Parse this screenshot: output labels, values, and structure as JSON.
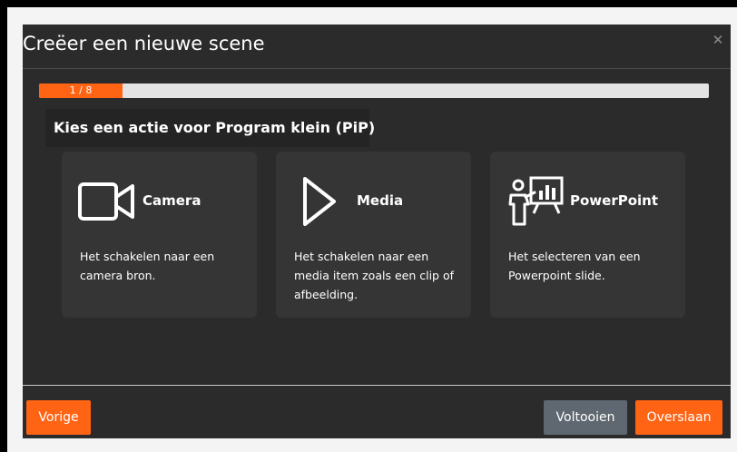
{
  "dialog": {
    "title": "Creëer een nieuwe scene",
    "close_icon": "close-icon"
  },
  "progress": {
    "label": "1 / 8",
    "current": 1,
    "total": 8
  },
  "step": {
    "heading": "Kies een actie voor Program klein (PiP)"
  },
  "cards": [
    {
      "title": "Camera",
      "icon": "video-camera-icon",
      "description": "Het schakelen naar een camera bron."
    },
    {
      "title": "Media",
      "icon": "play-icon",
      "description": "Het schakelen naar een media item zoals een clip of afbeelding."
    },
    {
      "title": "PowerPoint",
      "icon": "presenter-icon",
      "description": "Het selecteren van een Powerpoint slide."
    }
  ],
  "footer": {
    "previous_label": "Vorige",
    "finish_label": "Voltooien",
    "skip_label": "Overslaan"
  },
  "colors": {
    "accent": "#ff6415",
    "dialog_bg": "#2b2b2b",
    "card_bg": "#353535",
    "secondary_button": "#5f6870"
  }
}
